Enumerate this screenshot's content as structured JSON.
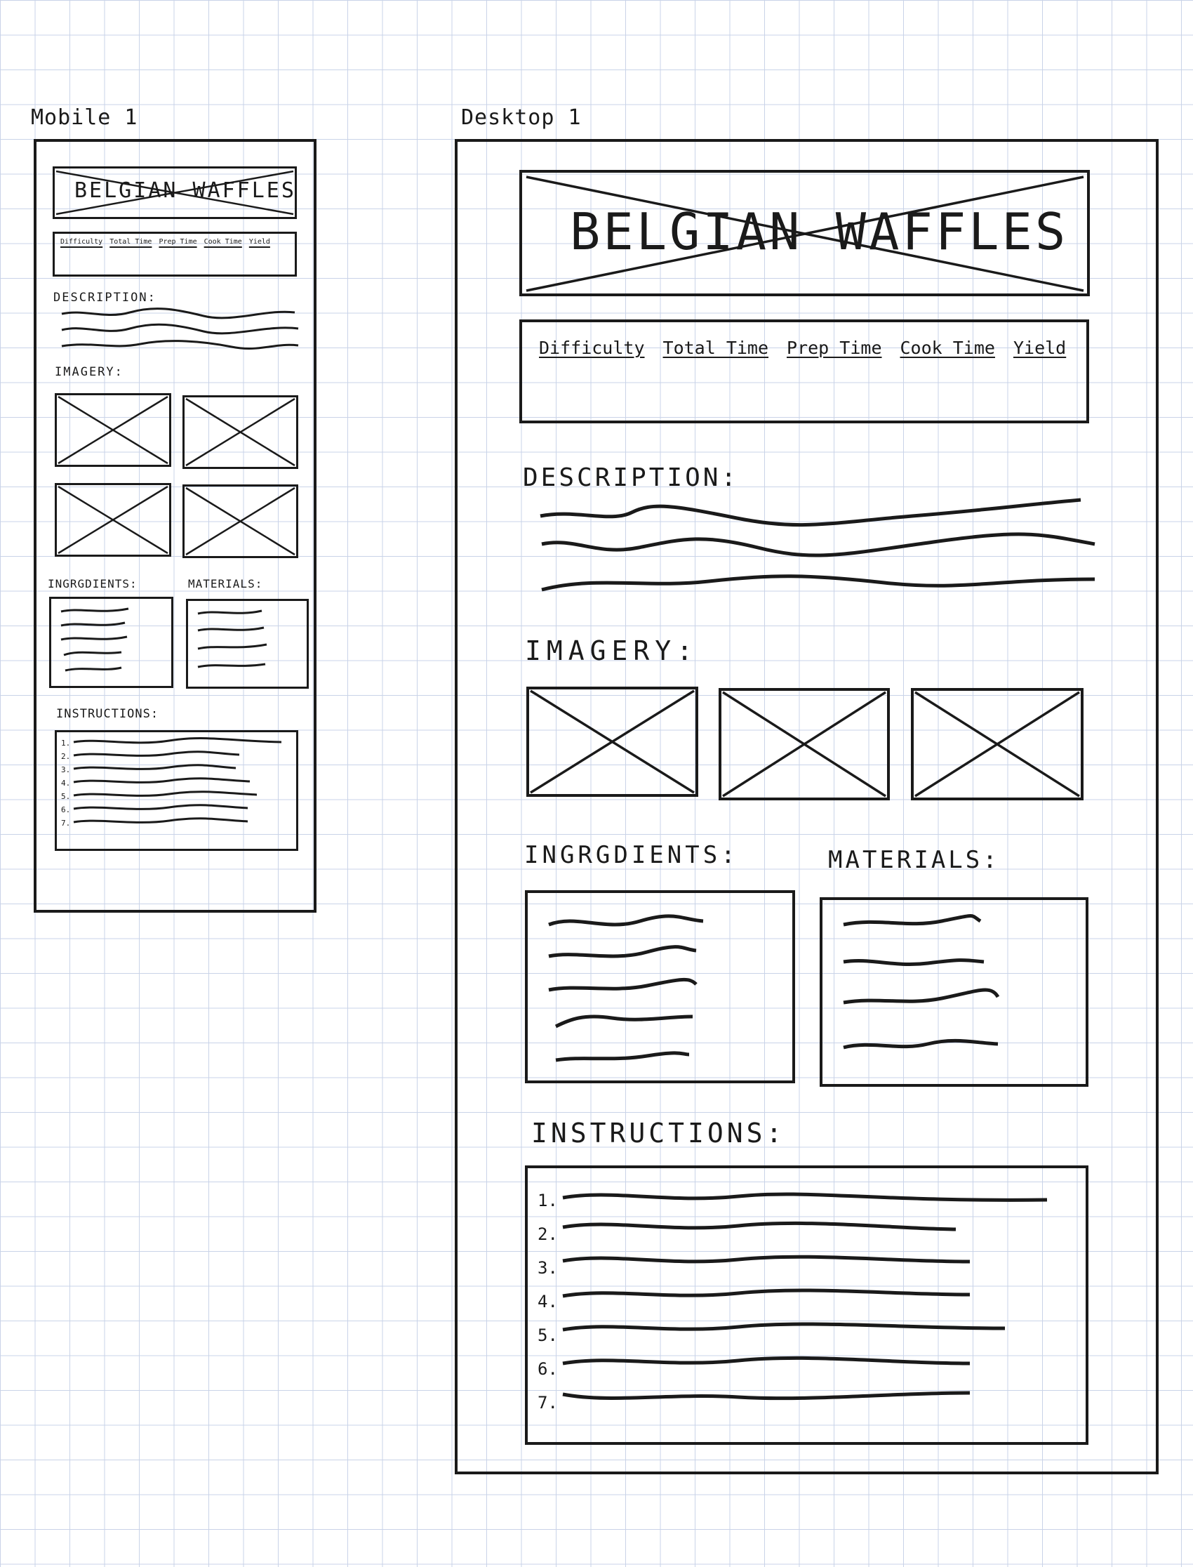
{
  "mobile": {
    "label": "Mobile 1",
    "title": "BELGIAN WAFFLES",
    "stats": [
      "Difficulty",
      "Total Time",
      "Prep Time",
      "Cook Time",
      "Yield"
    ],
    "description_label": "DESCRIPTION:",
    "imagery_label": "IMAGERY:",
    "ingredients_label": "INGRGDIENTS:",
    "materials_label": "MATERIALS:",
    "instructions_label": "INSTRUCTIONS:",
    "steps": [
      "1.",
      "2.",
      "3.",
      "4.",
      "5.",
      "6.",
      "7."
    ]
  },
  "desktop": {
    "label": "Desktop 1",
    "title": "BELGIAN WAFFLES",
    "stats": [
      "Difficulty",
      "Total Time",
      "Prep Time",
      "Cook Time",
      "Yield"
    ],
    "description_label": "DESCRIPTION:",
    "imagery_label": "IMAGERY:",
    "ingredients_label": "INGRGDIENTS:",
    "materials_label": "MATERIALS:",
    "instructions_label": "INSTRUCTIONS:",
    "steps": [
      "1.",
      "2.",
      "3.",
      "4.",
      "5.",
      "6.",
      "7."
    ]
  }
}
